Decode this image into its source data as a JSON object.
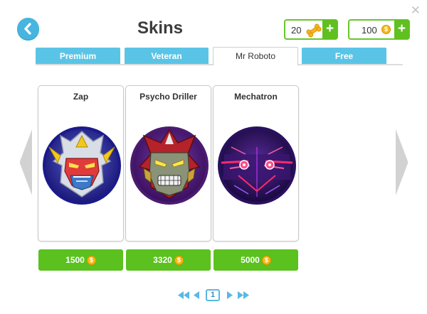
{
  "header": {
    "title": "Skins",
    "back_icon": "arrow-left-icon",
    "close_icon": "close-icon",
    "close_glyph": "✕"
  },
  "currencies": {
    "bones": {
      "amount": "20",
      "icon": "bone-icon",
      "add_label": "+"
    },
    "coins": {
      "amount": "100",
      "icon": "coin-icon",
      "add_label": "+"
    }
  },
  "tabs": [
    {
      "label": "Premium",
      "active": false
    },
    {
      "label": "Veteran",
      "active": false
    },
    {
      "label": "Mr Roboto",
      "active": true
    },
    {
      "label": "Free",
      "active": false
    }
  ],
  "skins": [
    {
      "name": "Zap",
      "price": "1500",
      "portrait": "zap-robot-portrait"
    },
    {
      "name": "Psycho Driller",
      "price": "3320",
      "portrait": "psycho-driller-robot-portrait"
    },
    {
      "name": "Mechatron",
      "price": "5000",
      "portrait": "mechatron-robot-portrait"
    }
  ],
  "pagination": {
    "current_page": "1",
    "icons": [
      "first-page-icon",
      "prev-page-icon",
      "next-page-icon",
      "last-page-icon"
    ]
  },
  "colors": {
    "accent_blue": "#46b5df",
    "buy_green": "#5ac11e",
    "coin_gold": "#f6b716"
  }
}
